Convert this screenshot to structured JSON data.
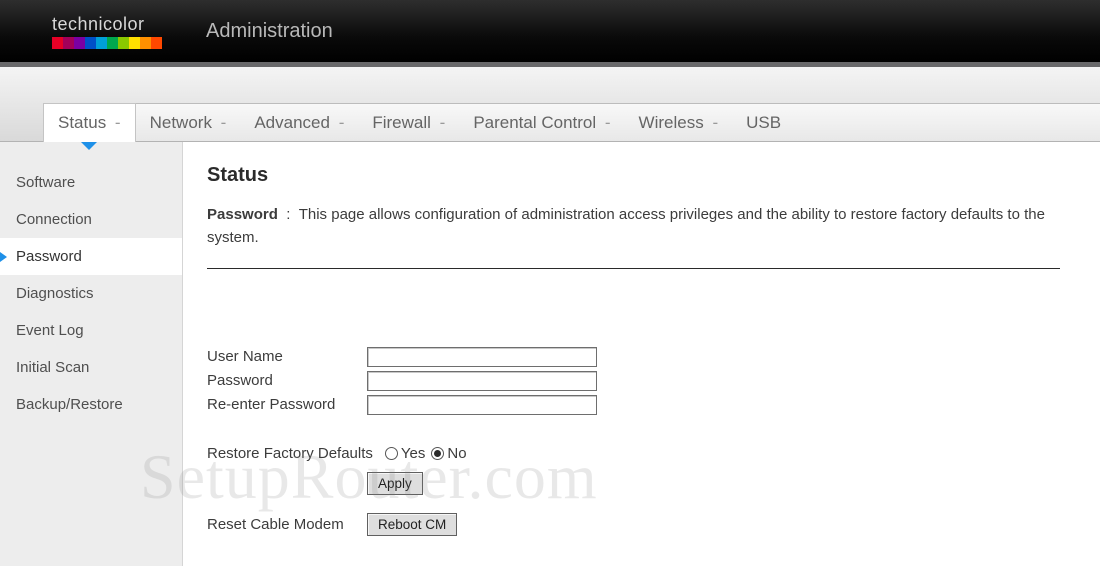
{
  "brand": {
    "name": "technicolor"
  },
  "header": {
    "section": "Administration"
  },
  "tabs": [
    {
      "label": "Status",
      "active": true
    },
    {
      "label": "Network",
      "active": false
    },
    {
      "label": "Advanced",
      "active": false
    },
    {
      "label": "Firewall",
      "active": false
    },
    {
      "label": "Parental Control",
      "active": false
    },
    {
      "label": "Wireless",
      "active": false
    },
    {
      "label": "USB",
      "active": false,
      "no_dash": true
    }
  ],
  "sidebar": {
    "items": [
      {
        "label": "Software"
      },
      {
        "label": "Connection"
      },
      {
        "label": "Password",
        "active": true
      },
      {
        "label": "Diagnostics"
      },
      {
        "label": "Event Log"
      },
      {
        "label": "Initial Scan"
      },
      {
        "label": "Backup/Restore"
      }
    ]
  },
  "page": {
    "title": "Status",
    "subtitle": "Password",
    "description": "This page allows configuration of administration access privileges and the ability to restore factory defaults to the system."
  },
  "form": {
    "username_label": "User Name",
    "username_value": "",
    "password_label": "Password",
    "password_value": "",
    "reenter_label": "Re-enter Password",
    "reenter_value": "",
    "restore_label": "Restore Factory Defaults",
    "restore_yes": "Yes",
    "restore_no": "No",
    "restore_selected": "No",
    "apply_label": "Apply",
    "reset_label": "Reset Cable Modem",
    "reboot_label": "Reboot CM"
  },
  "watermark": "SetupRouter.com"
}
